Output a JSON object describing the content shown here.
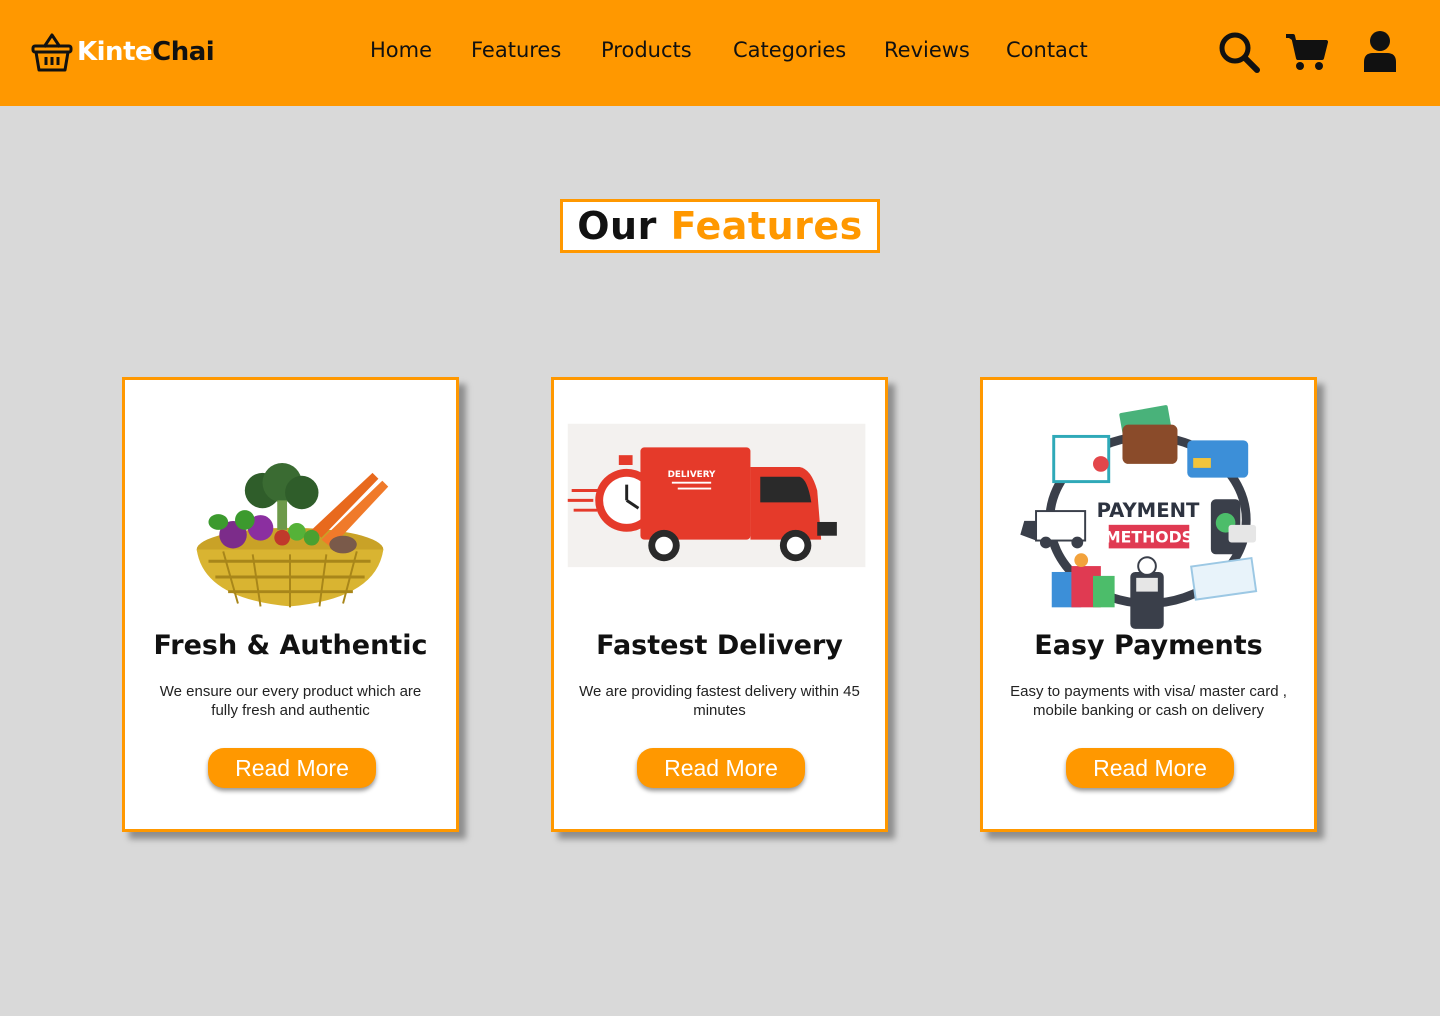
{
  "header": {
    "logo": {
      "part1": "Kinte",
      "part2": "Chai",
      "icon": "basket-icon"
    },
    "nav": [
      {
        "label": "Home"
      },
      {
        "label": "Features"
      },
      {
        "label": "Products"
      },
      {
        "label": "Categories"
      },
      {
        "label": "Reviews"
      },
      {
        "label": "Contact"
      }
    ],
    "icons": [
      "search-icon",
      "cart-icon",
      "user-icon"
    ]
  },
  "section": {
    "title_part1": "Our",
    "title_part2": "Features"
  },
  "cards": [
    {
      "title": "Fresh & Authentic",
      "description": "We ensure our every product which are fully fresh and authentic",
      "button": "Read More",
      "image": "vegetable-basket-image"
    },
    {
      "title": "Fastest Delivery",
      "description": "We are providing fastest delivery within 45 minutes",
      "button": "Read More",
      "image": "delivery-truck-image",
      "image_text": "DELIVERY"
    },
    {
      "title": "Easy Payments",
      "description": "Easy to payments with visa/ master card , mobile banking or cash on delivery",
      "button": "Read More",
      "image": "payment-methods-image",
      "image_text_1": "PAYMENT",
      "image_text_2": "METHODS"
    }
  ],
  "colors": {
    "accent": "#ff9800",
    "background": "#d9d9d9",
    "card": "#ffffff",
    "text": "#111111"
  }
}
